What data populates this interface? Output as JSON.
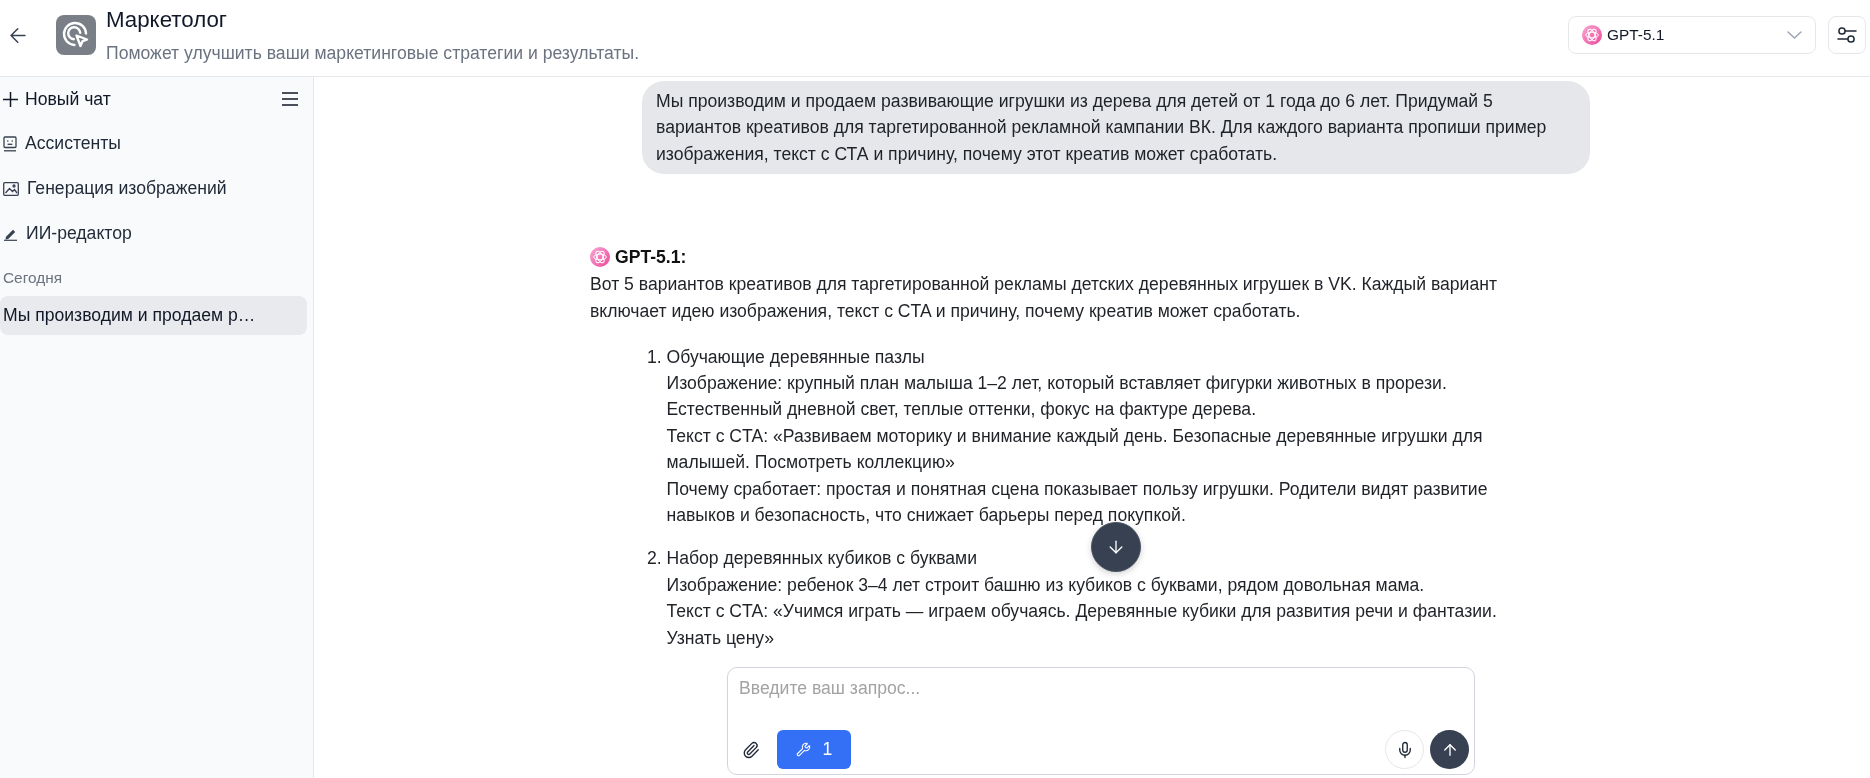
{
  "header": {
    "title": "Маркетолог",
    "subtitle": "Поможет улучшить ваши маркетинговые стратегии и результаты."
  },
  "model_select": {
    "value": "GPT-5.1"
  },
  "sidebar": {
    "new_chat": "Новый чат",
    "items": [
      {
        "kind": "assistants",
        "label": "Ассистенты"
      },
      {
        "kind": "images",
        "label": "Генерация изображений"
      },
      {
        "kind": "editor",
        "label": "ИИ-редактор"
      }
    ],
    "section": "Сегодня",
    "chats": [
      {
        "title": "Мы производим и продаем р…",
        "selected": true
      }
    ]
  },
  "messages": [
    {
      "kind": "user",
      "text": "Мы производим и продаем развивающие игрушки из дерева для детей от 1 года до 6 лет. Придумай 5 вариантов креативов для таргетированной рекламной кампании ВК. Для каждого варианта пропиши пример изображения, текст с СТА и причину, почему этот креатив может сработать."
    },
    {
      "kind": "assistant",
      "author": "GPT-5.1:",
      "intro": "Вот 5 вариантов креативов для таргетированной рекламы детских деревянных игрушек в VK. Каждый вариант включает идею изображения, текст с CTA и причину, почему креатив может сработать.",
      "list": [
        {
          "number": "1.",
          "title": "Обучающие деревянные пазлы",
          "lines": [
            "Изображение: крупный план малыша 1–2 лет, который вставляет фигурки животных в прорези. Естественный дневной свет, теплые оттенки, фокус на фактуре дерева.",
            "Текст с CTA: «Развиваем моторику и внимание каждый день. Безопасные деревянные игрушки для малышей. Посмотреть коллекцию»",
            "Почему сработает: простая и понятная сцена показывает пользу игрушки. Родители видят развитие навыков и безопасность, что снижает барьеры перед покупкой."
          ]
        },
        {
          "number": "2.",
          "title": "Набор деревянных кубиков с буквами",
          "lines": [
            "Изображение: ребенок 3–4 лет строит башню из кубиков с буквами, рядом довольная мама.",
            "Текст с CTA: «Учимся играть — играем обучаясь. Деревянные кубики для развития речи и фантазии. Узнать цену»"
          ]
        }
      ]
    }
  ],
  "composer": {
    "placeholder": "Введите ваш запрос...",
    "tools_button": "1"
  }
}
